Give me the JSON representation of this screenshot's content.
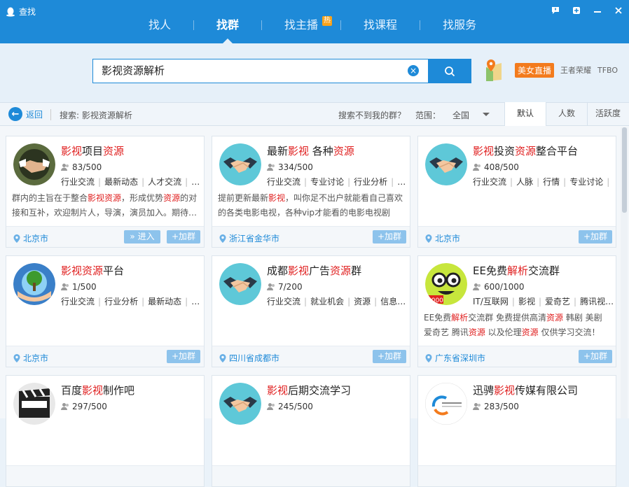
{
  "window": {
    "title": "查找",
    "controls": [
      "feedback-icon",
      "skin-icon",
      "minimize-icon",
      "close-icon"
    ]
  },
  "nav": {
    "tabs": [
      {
        "label": "找人",
        "active": false
      },
      {
        "label": "找群",
        "active": true
      },
      {
        "label": "找主播",
        "active": false,
        "badge": "热"
      },
      {
        "label": "找课程",
        "active": false
      },
      {
        "label": "找服务",
        "active": false
      }
    ]
  },
  "search": {
    "value": "影视资源解析",
    "clear_icon": "clear-icon",
    "button_icon": "search-icon"
  },
  "promo": {
    "live_label": "美女直播",
    "link1": "王者荣耀",
    "link2": "TFBO"
  },
  "filter": {
    "back_label": "返回",
    "query_text": "搜索: 影视资源解析",
    "not_found": "搜索不到我的群？",
    "range_label": "范围：",
    "range_value": "全国",
    "sort_tabs": [
      "默认",
      "人数",
      "活跃度"
    ]
  },
  "cards": [
    {
      "name_parts": [
        [
          "影视",
          true
        ],
        [
          "项目",
          false
        ],
        [
          "资源",
          true
        ]
      ],
      "members": "83/500",
      "tags": [
        "行业交流",
        "最新动态",
        "人才交流",
        "…"
      ],
      "desc_parts": [
        [
          "群内的主旨在于整合",
          false
        ],
        [
          "影视",
          true
        ],
        [
          "资源",
          true
        ],
        [
          "，形成优势",
          false
        ],
        [
          "资源",
          true
        ],
        [
          "的对接和互补，欢迎制片人，导演，演员加入。期待…",
          false
        ]
      ],
      "location": "北京市",
      "enter": "进入",
      "join": "+加群",
      "avatar": "handshake-photo"
    },
    {
      "name_parts": [
        [
          "最新",
          false
        ],
        [
          "影视",
          true
        ],
        [
          " 各种",
          false
        ],
        [
          "资源",
          true
        ]
      ],
      "members": "334/500",
      "tags": [
        "行业交流",
        "专业讨论",
        "行业分析",
        "…"
      ],
      "desc_parts": [
        [
          "提前更新最新",
          false
        ],
        [
          "影视",
          true
        ],
        [
          "，叫你足不出户就能看自己喜欢的各类电影电视，各种vip才能看的电影电视剧这…",
          false
        ]
      ],
      "location": "浙江省金华市",
      "join": "+加群",
      "avatar": "handshake-icon"
    },
    {
      "name_parts": [
        [
          "影视",
          true
        ],
        [
          "投资",
          false
        ],
        [
          "资源",
          true
        ],
        [
          "整合平台",
          false
        ]
      ],
      "members": "408/500",
      "tags": [
        "行业交流",
        "人脉",
        "行情",
        "专业讨论",
        "…"
      ],
      "desc_parts": [],
      "location": "北京市",
      "join": "+加群",
      "avatar": "handshake-icon"
    },
    {
      "name_parts": [
        [
          "影视",
          true
        ],
        [
          "资源",
          true
        ],
        [
          "平台",
          false
        ]
      ],
      "members": "1/500",
      "tags": [
        "行业交流",
        "行业分析",
        "最新动态",
        "…"
      ],
      "desc_parts": [],
      "location": "北京市",
      "join": "+加群",
      "avatar": "tree-globe-photo"
    },
    {
      "name_parts": [
        [
          "成都",
          false
        ],
        [
          "影视",
          true
        ],
        [
          "广告",
          false
        ],
        [
          "资源",
          true
        ],
        [
          "群",
          false
        ]
      ],
      "members": "7/200",
      "tags": [
        "行业交流",
        "就业机会",
        "资源",
        "信息…"
      ],
      "desc_parts": [],
      "location": "四川省成都市",
      "join": "+加群",
      "avatar": "handshake-icon"
    },
    {
      "name_parts": [
        [
          "EE免费",
          false
        ],
        [
          "解析",
          true
        ],
        [
          "交流群",
          false
        ]
      ],
      "members": "600/1000",
      "tags": [
        "IT/互联网",
        "影视",
        "爱奇艺",
        "腾讯视…"
      ],
      "desc_parts": [
        [
          "EE免费",
          false
        ],
        [
          "解析",
          true
        ],
        [
          "交流群 免费提供高清",
          false
        ],
        [
          "资源",
          true
        ],
        [
          " 韩剧 美剧 爱奇艺 腾讯",
          false
        ],
        [
          "资源",
          true
        ],
        [
          " 以及伦理",
          false
        ],
        [
          "资源",
          true
        ],
        [
          " 仅供学习交流！",
          false
        ]
      ],
      "location": "广东省深圳市",
      "join": "+加群",
      "avatar": "smiley-glasses-icon"
    },
    {
      "name_parts": [
        [
          "百度",
          false
        ],
        [
          "影视",
          true
        ],
        [
          "制作吧",
          false
        ]
      ],
      "members": "297/500",
      "tags": [],
      "desc_parts": [],
      "location": "",
      "join": "",
      "avatar": "clapperboard-photo"
    },
    {
      "name_parts": [
        [
          "影视",
          true
        ],
        [
          "后期交流学习",
          false
        ]
      ],
      "members": "245/500",
      "tags": [],
      "desc_parts": [],
      "location": "",
      "join": "",
      "avatar": "handshake-icon"
    },
    {
      "name_parts": [
        [
          "迅骋",
          false
        ],
        [
          "影视",
          true
        ],
        [
          "传媒有限公司",
          false
        ]
      ],
      "members": "283/500",
      "tags": [],
      "desc_parts": [],
      "location": "",
      "join": "",
      "avatar": "company-logo"
    }
  ],
  "colors": {
    "brand": "#1e8ad8",
    "highlight": "#e02020",
    "live": "#f37b1d",
    "hot": "#f7a21b"
  }
}
